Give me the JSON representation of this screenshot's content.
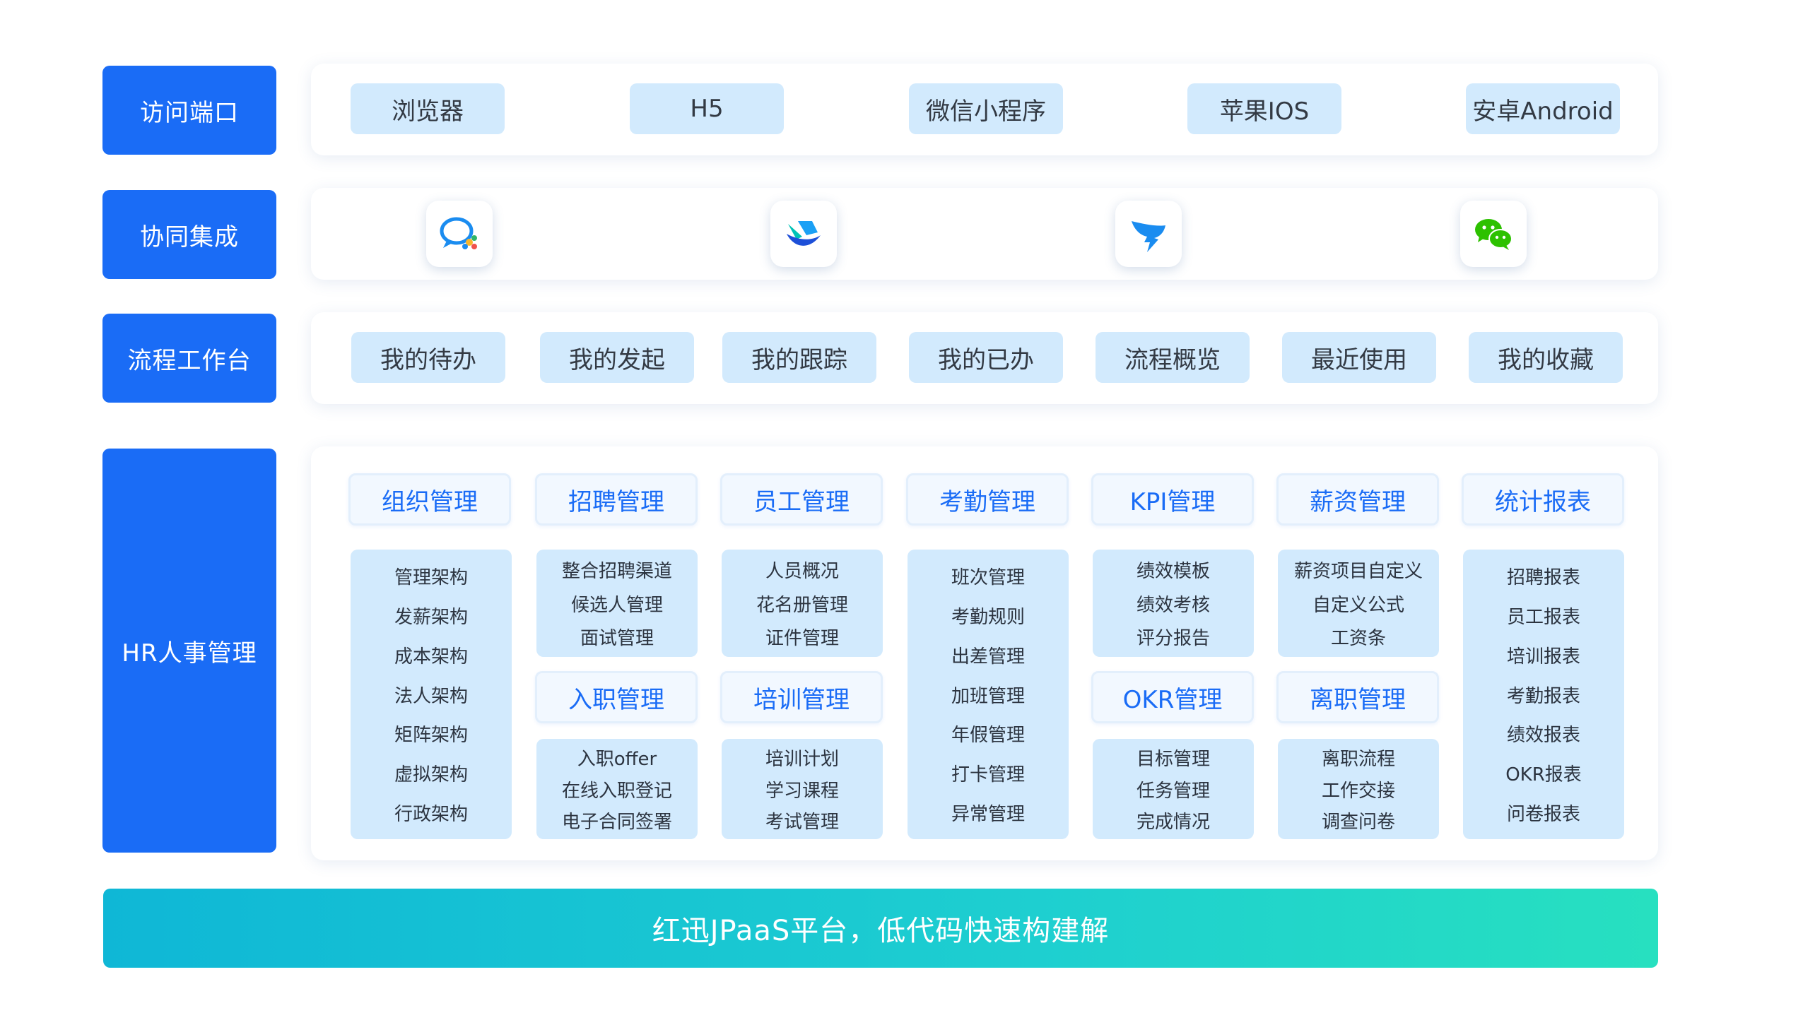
{
  "rows": {
    "access": {
      "label": "访问端口",
      "items": [
        "浏览器",
        "H5",
        "微信小程序",
        "苹果IOS",
        "安卓Android"
      ]
    },
    "collab": {
      "label": "协同集成",
      "apps": [
        {
          "icon": "wecom-icon"
        },
        {
          "icon": "feishu-icon"
        },
        {
          "icon": "dingtalk-icon"
        },
        {
          "icon": "wechat-icon"
        }
      ]
    },
    "workflow": {
      "label": "流程工作台",
      "items": [
        "我的待办",
        "我的发起",
        "我的跟踪",
        "我的已办",
        "流程概览",
        "最近使用",
        "我的收藏"
      ]
    },
    "hr": {
      "label": "HR人事管理",
      "modules": [
        {
          "title": "组织管理",
          "items": [
            "管理架构",
            "发薪架构",
            "成本架构",
            "法人架构",
            "矩阵架构",
            "虚拟架构",
            "行政架构"
          ]
        },
        {
          "title": "招聘管理",
          "items": [
            "整合招聘渠道",
            "候选人管理",
            "面试管理"
          ]
        },
        {
          "title": "入职管理",
          "items": [
            "入职offer",
            "在线入职登记",
            "电子合同签署"
          ]
        },
        {
          "title": "员工管理",
          "items": [
            "人员概况",
            "花名册管理",
            "证件管理"
          ]
        },
        {
          "title": "培训管理",
          "items": [
            "培训计划",
            "学习课程",
            "考试管理"
          ]
        },
        {
          "title": "考勤管理",
          "items": [
            "班次管理",
            "考勤规则",
            "出差管理",
            "加班管理",
            "年假管理",
            "打卡管理",
            "异常管理"
          ]
        },
        {
          "title": "KPI管理",
          "items": [
            "绩效模板",
            "绩效考核",
            "评分报告"
          ]
        },
        {
          "title": "OKR管理",
          "items": [
            "目标管理",
            "任务管理",
            "完成情况"
          ]
        },
        {
          "title": "薪资管理",
          "items": [
            "薪资项目自定义",
            "自定义公式",
            "工资条"
          ]
        },
        {
          "title": "离职管理",
          "items": [
            "离职流程",
            "工作交接",
            "调查问卷"
          ]
        },
        {
          "title": "统计报表",
          "items": [
            "招聘报表",
            "员工报表",
            "培训报表",
            "考勤报表",
            "绩效报表",
            "OKR报表",
            "问卷报表"
          ]
        }
      ]
    }
  },
  "banner": "红迅JPaaS平台，低代码快速构建解",
  "colors": {
    "primary": "#1a6cf6",
    "pill_bg": "#d2eafd",
    "banner_start": "#0fb7d6",
    "banner_end": "#27e0c0"
  }
}
